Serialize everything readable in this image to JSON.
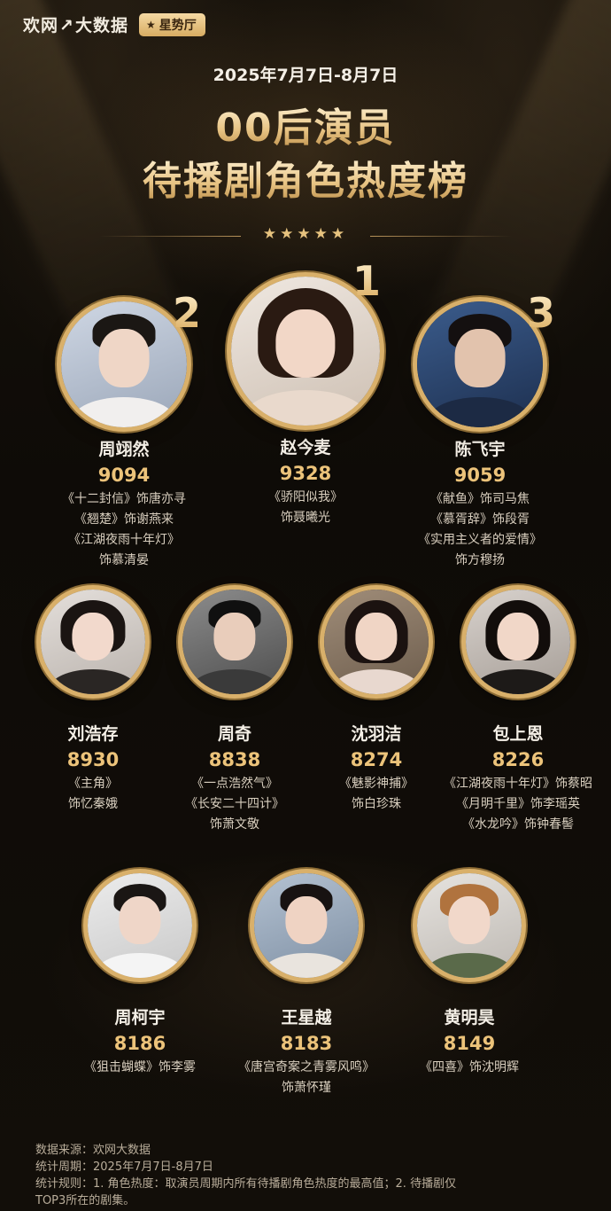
{
  "brand": {
    "logo_main": "欢网",
    "logo_slash": "↗",
    "logo_rest": "大数据",
    "tag": "星势厅",
    "tag_icon": "star-icon"
  },
  "header": {
    "date": "2025年7月7日-8月7日",
    "title_line1": "00后演员",
    "title_line2": "待播剧角色热度榜",
    "stars": "★★★★★"
  },
  "colors": {
    "accent": "#ecc37a",
    "ring": "#d9b06a",
    "background": "#0d0a07"
  },
  "ranking": [
    {
      "rank": "1",
      "name": "赵今麦",
      "score": "9328",
      "roles": [
        "《骄阳似我》",
        "饰聂曦光"
      ]
    },
    {
      "rank": "2",
      "name": "周翊然",
      "score": "9094",
      "roles": [
        "《十二封信》饰唐亦寻",
        "《翘楚》饰谢燕来",
        "《江湖夜雨十年灯》",
        "饰慕清晏"
      ]
    },
    {
      "rank": "3",
      "name": "陈飞宇",
      "score": "9059",
      "roles": [
        "《献鱼》饰司马焦",
        "《慕胥辞》饰段胥",
        "《实用主义者的爱情》",
        "饰方穆扬"
      ]
    },
    {
      "name": "刘浩存",
      "score": "8930",
      "roles": [
        "《主角》",
        "饰忆秦娥"
      ]
    },
    {
      "name": "周奇",
      "score": "8838",
      "roles": [
        "《一点浩然气》",
        "《长安二十四计》",
        "饰萧文敬"
      ]
    },
    {
      "name": "沈羽洁",
      "score": "8274",
      "roles": [
        "《魅影神捕》",
        "饰白珍珠"
      ]
    },
    {
      "name": "包上恩",
      "score": "8226",
      "roles": [
        "《江湖夜雨十年灯》饰蔡昭",
        "《月明千里》饰李瑶英",
        "《水龙吟》饰钟春髻"
      ]
    },
    {
      "name": "周柯宇",
      "score": "8186",
      "roles": [
        "《狙击蝴蝶》饰李雾"
      ]
    },
    {
      "name": "王星越",
      "score": "8183",
      "roles": [
        "《唐宫奇案之青雾风鸣》",
        "饰萧怀瑾"
      ]
    },
    {
      "name": "黄明昊",
      "score": "8149",
      "roles": [
        "《四喜》饰沈明辉"
      ]
    }
  ],
  "footer": {
    "source": "数据来源：欢网大数据",
    "period": "统计周期：2025年7月7日-8月7日",
    "rule": "统计规则：1. 角色热度：取演员周期内所有待播剧角色热度的最高值；2. 待播剧仅",
    "rule_cont": "TOP3所在的剧集。"
  }
}
